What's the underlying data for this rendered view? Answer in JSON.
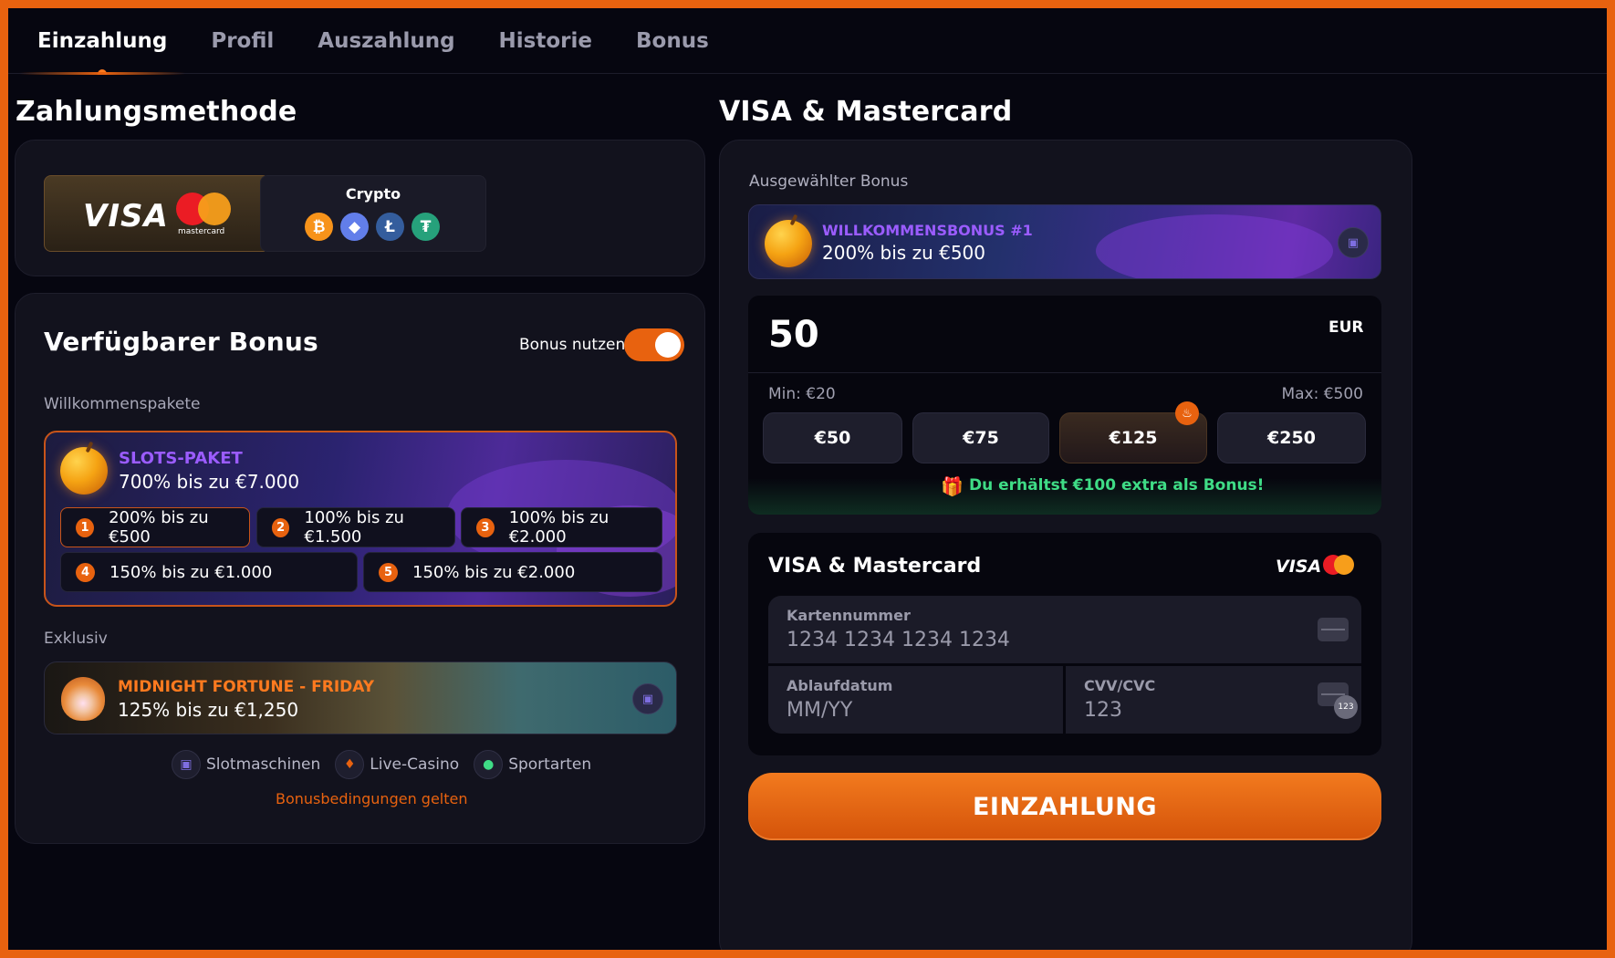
{
  "tabs": [
    {
      "label": "Einzahlung",
      "active": true
    },
    {
      "label": "Profil"
    },
    {
      "label": "Auszahlung"
    },
    {
      "label": "Historie"
    },
    {
      "label": "Bonus"
    }
  ],
  "left": {
    "payment_method_title": "Zahlungsmethode",
    "methods": {
      "card": {
        "visa": "VISA",
        "mastercard": "mastercard",
        "selected": true
      },
      "crypto": {
        "label": "Crypto",
        "coins": [
          "₿",
          "◆",
          "Ł",
          "₮"
        ]
      }
    },
    "bonus": {
      "title": "Verfügbarer Bonus",
      "toggle_label": "Bonus nutzen",
      "toggle_on": true,
      "welcome_label": "Willkommenspakete",
      "package": {
        "title": "SLOTS-PAKET",
        "subtitle": "700% bis zu €7.000",
        "tiers": [
          {
            "num": "1",
            "label": "200% bis zu €500"
          },
          {
            "num": "2",
            "label": "100% bis zu €1.500"
          },
          {
            "num": "3",
            "label": "100% bis zu €2.000"
          },
          {
            "num": "4",
            "label": "150% bis zu €1.000"
          },
          {
            "num": "5",
            "label": "150% bis zu €2.000"
          }
        ]
      },
      "exclusive_label": "Exklusiv",
      "exclusive": {
        "title": "MIDNIGHT FORTUNE - FRIDAY",
        "subtitle": "125% bis zu €1,250"
      },
      "categories": [
        "Slotmaschinen",
        "Live-Casino",
        "Sportarten"
      ],
      "terms": "Bonusbedingungen gelten"
    }
  },
  "right": {
    "title": "VISA & Mastercard",
    "selected_bonus_label": "Ausgewählter Bonus",
    "selected_bonus": {
      "title": "WILLKOMMENSBONUS #1",
      "subtitle": "200% bis zu €500"
    },
    "amount": "50",
    "currency": "EUR",
    "min": "Min: €20",
    "max": "Max: €500",
    "quick_amounts": [
      "€50",
      "€75",
      "€125",
      "€250"
    ],
    "extra_bonus": "Du erhältst €100 extra als Bonus!",
    "card_form": {
      "title": "VISA & Mastercard",
      "visa": "VISA",
      "card_number_label": "Kartennummer",
      "card_number_placeholder": "1234 1234 1234 1234",
      "expiry_label": "Ablaufdatum",
      "expiry_placeholder": "MM/YY",
      "cvv_label": "CVV/CVC",
      "cvv_placeholder": "123",
      "cvv_badge": "123"
    },
    "submit_label": "EINZAHLUNG"
  },
  "colors": {
    "accent": "#e8620f",
    "bonus_purple": "#9b5cff",
    "success_green": "#3fdc86",
    "background": "#060610"
  }
}
